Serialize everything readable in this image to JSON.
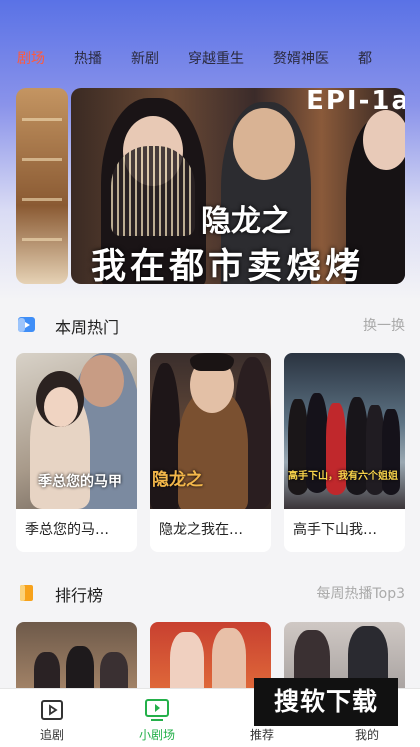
{
  "tabs": [
    "剧场",
    "热播",
    "新剧",
    "穿越重生",
    "赘婿神医",
    "都"
  ],
  "banner": {
    "corner_text": "EPI-1a",
    "subtitle": "隐龙之",
    "title": "我在都市卖烧烤"
  },
  "weekly": {
    "title": "本周热门",
    "more": "换一换",
    "icon": "play-square-icon",
    "cards": [
      {
        "caption": "季总您的马…",
        "stamp": "季总您的马甲\n又掉了"
      },
      {
        "caption": "隐龙之我在…",
        "stamp": "隐龙之"
      },
      {
        "caption": "高手下山我…",
        "stamp": "高手下山，我有六个姐姐"
      }
    ]
  },
  "ranking": {
    "title": "排行榜",
    "more": "每周热播Top3",
    "icon": "bookmark-icon"
  },
  "nav": [
    {
      "label": "追剧",
      "icon": "play-box-icon"
    },
    {
      "label": "小剧场",
      "icon": "tv-play-icon"
    },
    {
      "label": "推荐",
      "icon": "recommend-icon"
    },
    {
      "label": "我的",
      "icon": "profile-icon"
    }
  ],
  "watermark": "搜软下载",
  "colors": {
    "active_tab": "#ff5a3c",
    "active_nav": "#24b04a",
    "accent_blue": "#3f8ef7",
    "accent_orange": "#f7a21b"
  }
}
